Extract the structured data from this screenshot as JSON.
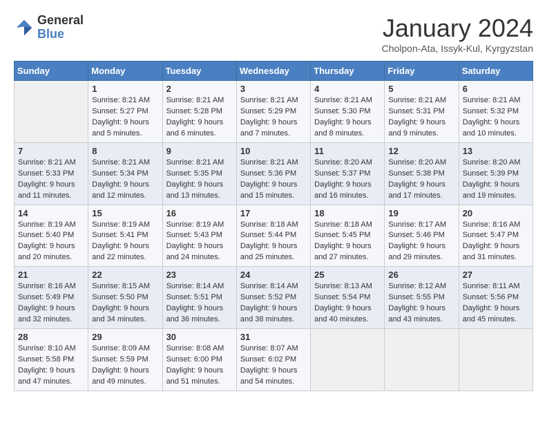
{
  "logo": {
    "general": "General",
    "blue": "Blue"
  },
  "header": {
    "title": "January 2024",
    "subtitle": "Cholpon-Ata, Issyk-Kul, Kyrgyzstan"
  },
  "days_of_week": [
    "Sunday",
    "Monday",
    "Tuesday",
    "Wednesday",
    "Thursday",
    "Friday",
    "Saturday"
  ],
  "weeks": [
    [
      {
        "day": "",
        "content": ""
      },
      {
        "day": "1",
        "content": "Sunrise: 8:21 AM\nSunset: 5:27 PM\nDaylight: 9 hours\nand 5 minutes."
      },
      {
        "day": "2",
        "content": "Sunrise: 8:21 AM\nSunset: 5:28 PM\nDaylight: 9 hours\nand 6 minutes."
      },
      {
        "day": "3",
        "content": "Sunrise: 8:21 AM\nSunset: 5:29 PM\nDaylight: 9 hours\nand 7 minutes."
      },
      {
        "day": "4",
        "content": "Sunrise: 8:21 AM\nSunset: 5:30 PM\nDaylight: 9 hours\nand 8 minutes."
      },
      {
        "day": "5",
        "content": "Sunrise: 8:21 AM\nSunset: 5:31 PM\nDaylight: 9 hours\nand 9 minutes."
      },
      {
        "day": "6",
        "content": "Sunrise: 8:21 AM\nSunset: 5:32 PM\nDaylight: 9 hours\nand 10 minutes."
      }
    ],
    [
      {
        "day": "7",
        "content": "Sunrise: 8:21 AM\nSunset: 5:33 PM\nDaylight: 9 hours\nand 11 minutes."
      },
      {
        "day": "8",
        "content": "Sunrise: 8:21 AM\nSunset: 5:34 PM\nDaylight: 9 hours\nand 12 minutes."
      },
      {
        "day": "9",
        "content": "Sunrise: 8:21 AM\nSunset: 5:35 PM\nDaylight: 9 hours\nand 13 minutes."
      },
      {
        "day": "10",
        "content": "Sunrise: 8:21 AM\nSunset: 5:36 PM\nDaylight: 9 hours\nand 15 minutes."
      },
      {
        "day": "11",
        "content": "Sunrise: 8:20 AM\nSunset: 5:37 PM\nDaylight: 9 hours\nand 16 minutes."
      },
      {
        "day": "12",
        "content": "Sunrise: 8:20 AM\nSunset: 5:38 PM\nDaylight: 9 hours\nand 17 minutes."
      },
      {
        "day": "13",
        "content": "Sunrise: 8:20 AM\nSunset: 5:39 PM\nDaylight: 9 hours\nand 19 minutes."
      }
    ],
    [
      {
        "day": "14",
        "content": "Sunrise: 8:19 AM\nSunset: 5:40 PM\nDaylight: 9 hours\nand 20 minutes."
      },
      {
        "day": "15",
        "content": "Sunrise: 8:19 AM\nSunset: 5:41 PM\nDaylight: 9 hours\nand 22 minutes."
      },
      {
        "day": "16",
        "content": "Sunrise: 8:19 AM\nSunset: 5:43 PM\nDaylight: 9 hours\nand 24 minutes."
      },
      {
        "day": "17",
        "content": "Sunrise: 8:18 AM\nSunset: 5:44 PM\nDaylight: 9 hours\nand 25 minutes."
      },
      {
        "day": "18",
        "content": "Sunrise: 8:18 AM\nSunset: 5:45 PM\nDaylight: 9 hours\nand 27 minutes."
      },
      {
        "day": "19",
        "content": "Sunrise: 8:17 AM\nSunset: 5:46 PM\nDaylight: 9 hours\nand 29 minutes."
      },
      {
        "day": "20",
        "content": "Sunrise: 8:16 AM\nSunset: 5:47 PM\nDaylight: 9 hours\nand 31 minutes."
      }
    ],
    [
      {
        "day": "21",
        "content": "Sunrise: 8:16 AM\nSunset: 5:49 PM\nDaylight: 9 hours\nand 32 minutes."
      },
      {
        "day": "22",
        "content": "Sunrise: 8:15 AM\nSunset: 5:50 PM\nDaylight: 9 hours\nand 34 minutes."
      },
      {
        "day": "23",
        "content": "Sunrise: 8:14 AM\nSunset: 5:51 PM\nDaylight: 9 hours\nand 36 minutes."
      },
      {
        "day": "24",
        "content": "Sunrise: 8:14 AM\nSunset: 5:52 PM\nDaylight: 9 hours\nand 38 minutes."
      },
      {
        "day": "25",
        "content": "Sunrise: 8:13 AM\nSunset: 5:54 PM\nDaylight: 9 hours\nand 40 minutes."
      },
      {
        "day": "26",
        "content": "Sunrise: 8:12 AM\nSunset: 5:55 PM\nDaylight: 9 hours\nand 43 minutes."
      },
      {
        "day": "27",
        "content": "Sunrise: 8:11 AM\nSunset: 5:56 PM\nDaylight: 9 hours\nand 45 minutes."
      }
    ],
    [
      {
        "day": "28",
        "content": "Sunrise: 8:10 AM\nSunset: 5:58 PM\nDaylight: 9 hours\nand 47 minutes."
      },
      {
        "day": "29",
        "content": "Sunrise: 8:09 AM\nSunset: 5:59 PM\nDaylight: 9 hours\nand 49 minutes."
      },
      {
        "day": "30",
        "content": "Sunrise: 8:08 AM\nSunset: 6:00 PM\nDaylight: 9 hours\nand 51 minutes."
      },
      {
        "day": "31",
        "content": "Sunrise: 8:07 AM\nSunset: 6:02 PM\nDaylight: 9 hours\nand 54 minutes."
      },
      {
        "day": "",
        "content": ""
      },
      {
        "day": "",
        "content": ""
      },
      {
        "day": "",
        "content": ""
      }
    ]
  ]
}
